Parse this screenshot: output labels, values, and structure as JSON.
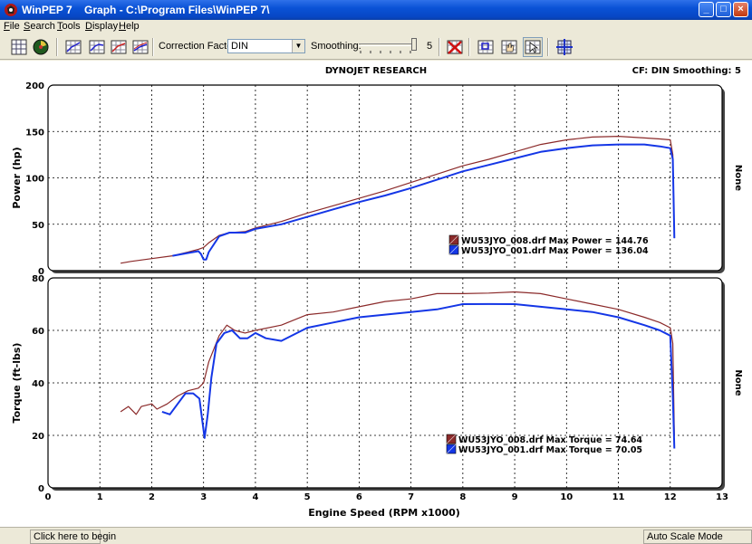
{
  "window": {
    "title": "WinPEP 7    Graph - C:\\Program Files\\WinPEP 7\\"
  },
  "menu": [
    {
      "label": "File",
      "key": "F"
    },
    {
      "label": "Search",
      "key": "S"
    },
    {
      "label": "Tools",
      "key": "T"
    },
    {
      "label": "Display",
      "key": "D"
    },
    {
      "label": "Help",
      "key": "H"
    }
  ],
  "toolbar": {
    "correction_factor_label": "Correction Factor:",
    "correction_factor_value": "DIN",
    "smoothing_label": "Smoothing:",
    "smoothing_value": "5",
    "smoothing_level": 1.0
  },
  "graph": {
    "header_center": "DYNOJET RESEARCH",
    "header_right": "CF: DIN  Smoothing: 5",
    "xlabel": "Engine Speed (RPM x1000)",
    "xticks": [
      "0",
      "1",
      "2",
      "3",
      "4",
      "5",
      "6",
      "7",
      "8",
      "9",
      "10",
      "11",
      "12",
      "13"
    ],
    "side_label": "None"
  },
  "status": {
    "hint": "Click here to begin",
    "mode": "Auto Scale Mode"
  },
  "colors": {
    "run1": "#8b2a2a",
    "run2": "#1436e6",
    "window_blue": "#0a52d6",
    "background": "#ece9d8"
  },
  "chart_data": [
    {
      "type": "line",
      "ylabel": "Power (hp)",
      "ylim": [
        0,
        200
      ],
      "yticks": [
        0,
        50,
        100,
        150,
        200
      ],
      "xlim": [
        0,
        13
      ],
      "legend": [
        "WU53JYO_008.drf Max Power = 144.76",
        "WU53JYO_001.drf Max Power = 136.04"
      ],
      "series": [
        {
          "name": "WU53JYO_008.drf",
          "color_key": "run1",
          "x": [
            1.4,
            1.6,
            2.0,
            2.4,
            2.7,
            2.9,
            3.0,
            3.1,
            3.3,
            3.5,
            3.8,
            4.0,
            4.5,
            5.0,
            5.5,
            6.0,
            6.5,
            7.0,
            7.5,
            8.0,
            8.5,
            9.0,
            9.5,
            10.0,
            10.5,
            11.0,
            11.5,
            11.8,
            12.0,
            12.05,
            12.08
          ],
          "y": [
            8,
            10,
            13,
            16,
            20,
            23,
            25,
            30,
            38,
            41,
            42,
            46,
            53,
            62,
            70,
            78,
            86,
            95,
            104,
            113,
            120,
            128,
            136,
            141,
            144,
            144.76,
            143,
            142,
            141,
            125,
            35
          ]
        },
        {
          "name": "WU53JYO_001.drf",
          "color_key": "run2",
          "x": [
            2.4,
            2.7,
            2.9,
            2.95,
            3.0,
            3.05,
            3.1,
            3.3,
            3.5,
            3.8,
            4.0,
            4.5,
            5.0,
            5.5,
            6.0,
            6.5,
            7.0,
            7.5,
            8.0,
            8.5,
            9.0,
            9.5,
            10.0,
            10.5,
            11.0,
            11.5,
            11.8,
            12.0,
            12.05,
            12.08
          ],
          "y": [
            16,
            19,
            21,
            18,
            12,
            12,
            20,
            37,
            41,
            41,
            45,
            50,
            58,
            66,
            74,
            81,
            89,
            98,
            107,
            114,
            121,
            128,
            132,
            135,
            136,
            136.04,
            134,
            132,
            120,
            35
          ]
        }
      ]
    },
    {
      "type": "line",
      "ylabel": "Torque (ft-lbs)",
      "ylim": [
        0,
        80
      ],
      "yticks": [
        0,
        20,
        40,
        60,
        80
      ],
      "xlim": [
        0,
        13
      ],
      "legend": [
        "WU53JYO_008.drf Max Torque = 74.64",
        "WU53JYO_001.drf Max Torque = 70.05"
      ],
      "series": [
        {
          "name": "WU53JYO_008.drf",
          "color_key": "run1",
          "x": [
            1.4,
            1.55,
            1.7,
            1.8,
            2.0,
            2.1,
            2.3,
            2.5,
            2.7,
            2.9,
            3.0,
            3.1,
            3.3,
            3.45,
            3.6,
            3.8,
            4.0,
            4.5,
            5.0,
            5.5,
            6.0,
            6.5,
            7.0,
            7.5,
            8.0,
            8.5,
            9.0,
            9.5,
            10.0,
            10.5,
            11.0,
            11.5,
            11.8,
            12.0,
            12.05,
            12.08
          ],
          "y": [
            29,
            31,
            28,
            31,
            32,
            30,
            32,
            35,
            37,
            38,
            40,
            48,
            58,
            62,
            60,
            59,
            60,
            62,
            66,
            67,
            69,
            71,
            72,
            74,
            74,
            74.2,
            74.64,
            74,
            72,
            70,
            68,
            65,
            63,
            61,
            55,
            20
          ]
        },
        {
          "name": "WU53JYO_001.drf",
          "color_key": "run2",
          "x": [
            2.2,
            2.35,
            2.5,
            2.65,
            2.8,
            2.92,
            2.98,
            3.02,
            3.08,
            3.15,
            3.25,
            3.4,
            3.55,
            3.7,
            3.85,
            4.0,
            4.2,
            4.5,
            5.0,
            5.5,
            6.0,
            6.5,
            7.0,
            7.5,
            8.0,
            8.5,
            9.0,
            9.5,
            10.0,
            10.5,
            11.0,
            11.5,
            11.8,
            12.0,
            12.05,
            12.08
          ],
          "y": [
            29,
            28,
            32,
            36,
            36,
            34,
            25,
            19,
            28,
            42,
            55,
            59,
            60,
            57,
            57,
            59,
            57,
            56,
            61,
            63,
            65,
            66,
            67,
            68,
            70,
            70.05,
            70,
            69,
            68,
            67,
            65,
            62,
            60,
            58,
            35,
            15
          ]
        }
      ]
    }
  ]
}
